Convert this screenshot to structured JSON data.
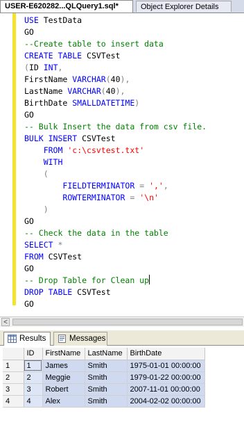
{
  "tabs": {
    "active_label": "USER-E620282...QLQuery1.sql*",
    "inactive_label": "Object Explorer Details"
  },
  "editor": {
    "lines": [
      [
        {
          "t": "kw",
          "v": "USE"
        },
        {
          "t": "tx",
          "v": " TestData"
        }
      ],
      [
        {
          "t": "tx",
          "v": "GO"
        }
      ],
      [
        {
          "t": "cm",
          "v": "--Create table to insert data"
        }
      ],
      [
        {
          "t": "kw",
          "v": "CREATE TABLE"
        },
        {
          "t": "tx",
          "v": " CSVTest"
        }
      ],
      [
        {
          "t": "op",
          "v": "("
        },
        {
          "t": "tx",
          "v": "ID "
        },
        {
          "t": "kw",
          "v": "INT"
        },
        {
          "t": "op",
          "v": ","
        }
      ],
      [
        {
          "t": "tx",
          "v": "FirstName "
        },
        {
          "t": "kw",
          "v": "VARCHAR"
        },
        {
          "t": "op",
          "v": "("
        },
        {
          "t": "tx",
          "v": "40"
        },
        {
          "t": "op",
          "v": "),"
        }
      ],
      [
        {
          "t": "tx",
          "v": "LastName "
        },
        {
          "t": "kw",
          "v": "VARCHAR"
        },
        {
          "t": "op",
          "v": "("
        },
        {
          "t": "tx",
          "v": "40"
        },
        {
          "t": "op",
          "v": "),"
        }
      ],
      [
        {
          "t": "tx",
          "v": "BirthDate "
        },
        {
          "t": "kw",
          "v": "SMALLDATETIME"
        },
        {
          "t": "op",
          "v": ")"
        }
      ],
      [
        {
          "t": "tx",
          "v": "GO"
        }
      ],
      [
        {
          "t": "cm",
          "v": "-- Bulk Insert the data from csv file."
        }
      ],
      [
        {
          "t": "kw",
          "v": "BULK INSERT"
        },
        {
          "t": "tx",
          "v": " CSVTest"
        }
      ],
      [
        {
          "t": "tx",
          "v": "    "
        },
        {
          "t": "kw",
          "v": "FROM"
        },
        {
          "t": "tx",
          "v": " "
        },
        {
          "t": "st",
          "v": "'c:\\csvtest.txt'"
        }
      ],
      [
        {
          "t": "tx",
          "v": "    "
        },
        {
          "t": "kw",
          "v": "WITH"
        }
      ],
      [
        {
          "t": "tx",
          "v": "    "
        },
        {
          "t": "op",
          "v": "("
        }
      ],
      [
        {
          "t": "tx",
          "v": "        "
        },
        {
          "t": "kw",
          "v": "FIELDTERMINATOR"
        },
        {
          "t": "tx",
          "v": " "
        },
        {
          "t": "op",
          "v": "="
        },
        {
          "t": "tx",
          "v": " "
        },
        {
          "t": "st",
          "v": "','"
        },
        {
          "t": "op",
          "v": ","
        }
      ],
      [
        {
          "t": "tx",
          "v": "        "
        },
        {
          "t": "kw",
          "v": "ROWTERMINATOR"
        },
        {
          "t": "tx",
          "v": " "
        },
        {
          "t": "op",
          "v": "="
        },
        {
          "t": "tx",
          "v": " "
        },
        {
          "t": "st",
          "v": "'\\n'"
        }
      ],
      [
        {
          "t": "tx",
          "v": "    "
        },
        {
          "t": "op",
          "v": ")"
        }
      ],
      [
        {
          "t": "tx",
          "v": "GO"
        }
      ],
      [
        {
          "t": "cm",
          "v": "-- Check the data in the table"
        }
      ],
      [
        {
          "t": "kw",
          "v": "SELECT"
        },
        {
          "t": "tx",
          "v": " "
        },
        {
          "t": "op",
          "v": "*"
        }
      ],
      [
        {
          "t": "kw",
          "v": "FROM"
        },
        {
          "t": "tx",
          "v": " CSVTest"
        }
      ],
      [
        {
          "t": "tx",
          "v": "GO"
        }
      ],
      [
        {
          "t": "cm",
          "v": "-- Drop Table for Clean up"
        },
        {
          "t": "caret",
          "v": ""
        }
      ],
      [
        {
          "t": "kw",
          "v": "DROP TABLE"
        },
        {
          "t": "tx",
          "v": " CSVTest"
        }
      ],
      [
        {
          "t": "tx",
          "v": "GO"
        }
      ]
    ]
  },
  "scrollbar": {
    "left_arrow": "<"
  },
  "results_tabs": {
    "results_label": "Results",
    "messages_label": "Messages"
  },
  "grid": {
    "columns": [
      "ID",
      "FirstName",
      "LastName",
      "BirthDate"
    ],
    "rows": [
      {
        "num": "1",
        "id": "1",
        "first": "James",
        "last": "Smith",
        "birth": "1975-01-01 00:00:00"
      },
      {
        "num": "2",
        "id": "2",
        "first": "Meggie",
        "last": "Smith",
        "birth": "1979-01-22 00:00:00"
      },
      {
        "num": "3",
        "id": "3",
        "first": "Robert",
        "last": "Smith",
        "birth": "2007-11-01 00:00:00"
      },
      {
        "num": "4",
        "id": "4",
        "first": "Alex",
        "last": "Smith",
        "birth": "2004-02-02 00:00:00"
      }
    ]
  },
  "colors": {
    "keyword": "#0000ff",
    "comment": "#008000",
    "string": "#ff0000",
    "operator": "#808080",
    "change_bar": "#f4e32a",
    "selection": "#cfdaf0"
  }
}
